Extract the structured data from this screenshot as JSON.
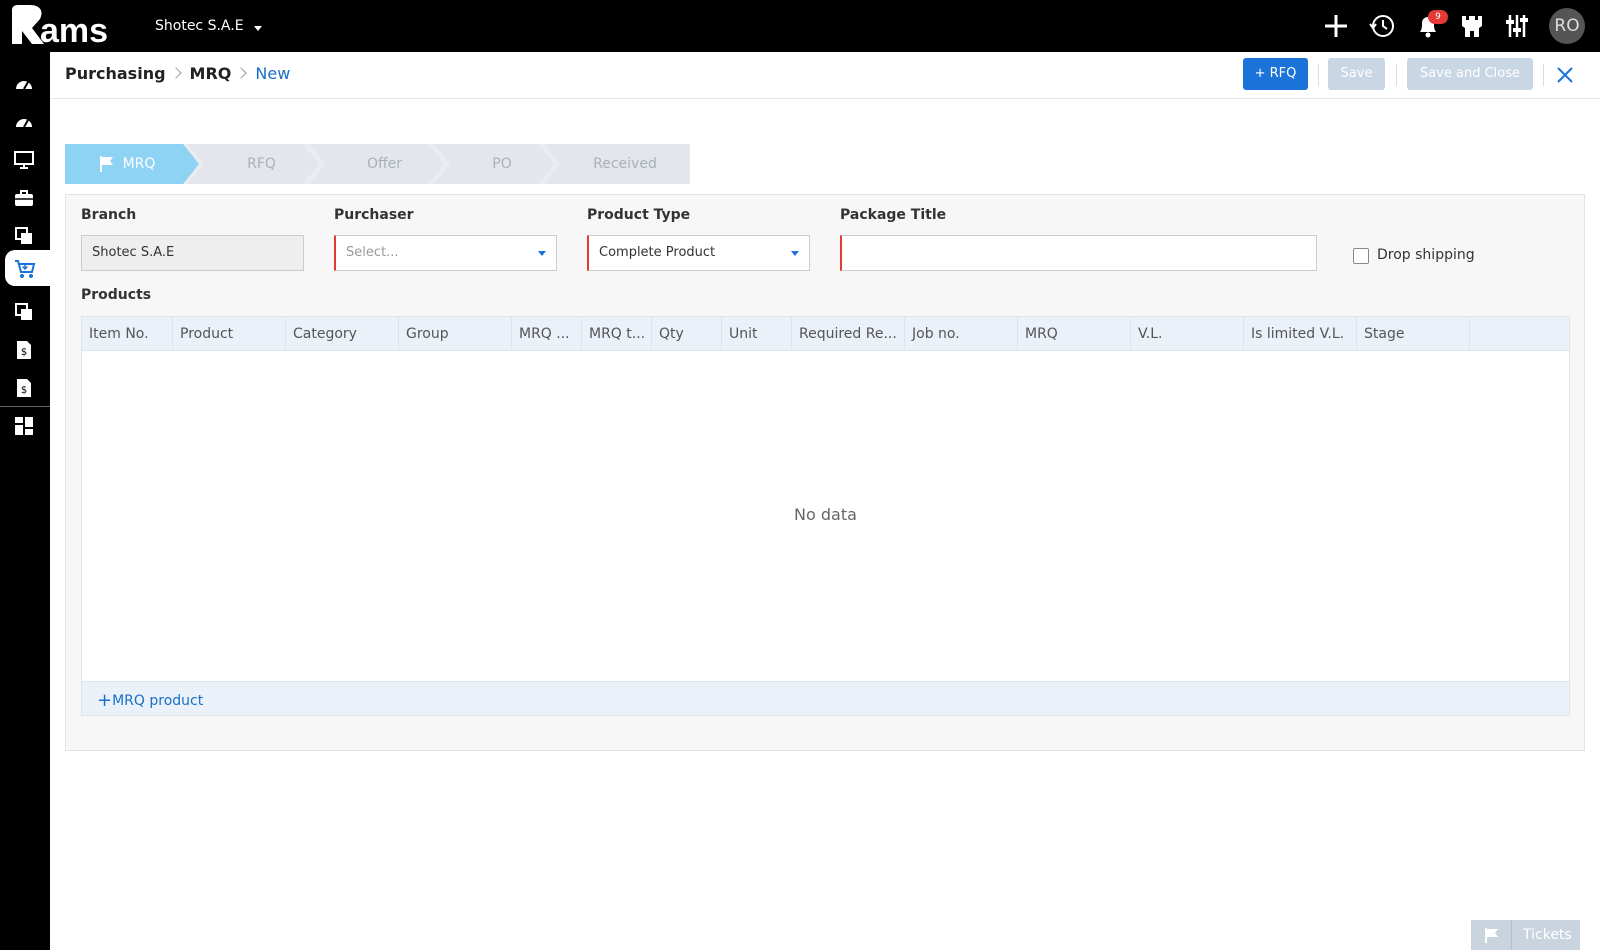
{
  "app": {
    "logo_alt": "Rams",
    "company": "Shotec S.A.E",
    "notifications_count": "9",
    "avatar_initials": "RO"
  },
  "top_icons": [
    "add-icon",
    "history-icon",
    "bell-icon",
    "castle-icon",
    "sliders-icon"
  ],
  "sidebar": {
    "items": [
      "dashboard-icon",
      "dashboard-icon",
      "monitor-icon",
      "briefcase-icon",
      "layers-icon",
      "cart-icon",
      "layers-icon",
      "invoice-icon",
      "invoice-icon",
      "grid-icon"
    ],
    "active": "cart-icon"
  },
  "header": {
    "breadcrumb": [
      "Purchasing",
      "MRQ",
      "New"
    ],
    "rfq_button": "+ RFQ",
    "save_button": "Save",
    "save_close_button": "Save and Close"
  },
  "steps": [
    "MRQ",
    "RFQ",
    "Offer",
    "PO",
    "Received"
  ],
  "form": {
    "branch_label": "Branch",
    "branch_value": "Shotec S.A.E",
    "purchaser_label": "Purchaser",
    "purchaser_placeholder": "Select...",
    "product_type_label": "Product Type",
    "product_type_value": "Complete Product",
    "package_title_label": "Package Title",
    "package_title_value": "",
    "drop_shipping_label": "Drop shipping",
    "drop_shipping_checked": false
  },
  "products": {
    "label": "Products",
    "columns": [
      "Item No.",
      "Product",
      "Category",
      "Group",
      "MRQ ...",
      "MRQ t...",
      "Qty",
      "Unit",
      "Required Re...",
      "Job no.",
      "MRQ",
      "V.L.",
      "Is limited V.L.",
      "Stage",
      ""
    ],
    "rows": [],
    "empty_text": "No data",
    "add_button": "MRQ product"
  },
  "tickets": {
    "label": "Tickets"
  },
  "colors": {
    "accent": "#1a73d9",
    "step_active": "#8fd3f4",
    "required": "#e53935"
  }
}
